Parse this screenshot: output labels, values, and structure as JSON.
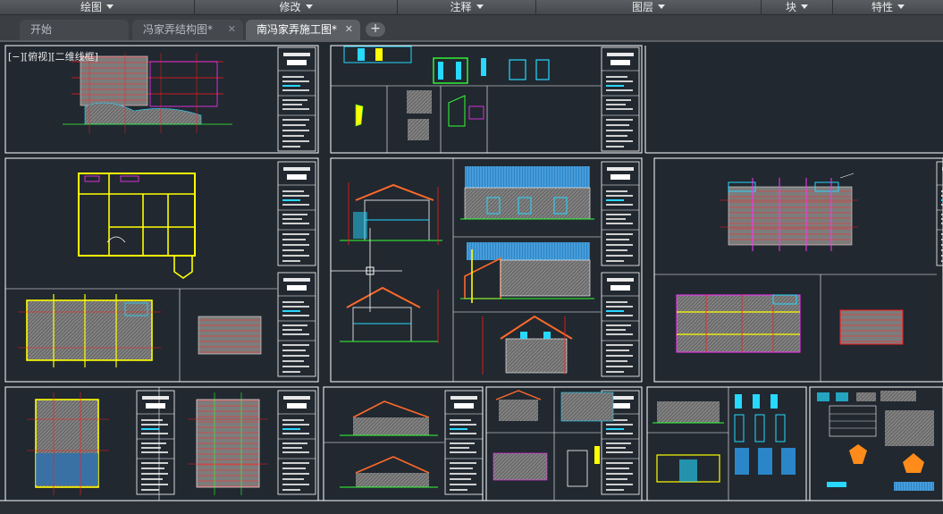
{
  "ribbon_panels": [
    {
      "label": "绘图"
    },
    {
      "label": "修改"
    },
    {
      "label": "注释"
    },
    {
      "label": "图层"
    },
    {
      "label": "块"
    },
    {
      "label": "特性"
    }
  ],
  "tabs": [
    {
      "label": "开始",
      "active": false,
      "closable": false
    },
    {
      "label": "冯家弄结构图*",
      "active": false,
      "closable": true
    },
    {
      "label": "南冯家弄施工图*",
      "active": true,
      "closable": true
    }
  ],
  "add_tab_icon": "plus-icon",
  "close_icon": "✕",
  "viewport": {
    "label": "[−][俯视][二维线框]",
    "background": "#212830"
  },
  "colors": {
    "sheet_border": "#ffffff",
    "red_line": "#ff1a1a",
    "yellow_line": "#ffff00",
    "cyan_line": "#27d8ff",
    "green_line": "#33ff33",
    "magenta_line": "#ff33ff",
    "hatch_gray": "#8a8a8a"
  }
}
